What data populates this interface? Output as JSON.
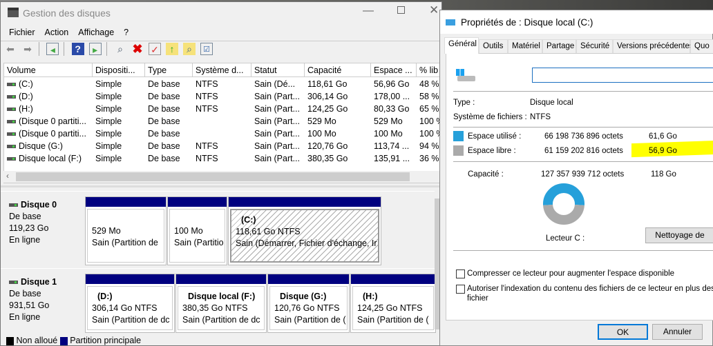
{
  "main_window": {
    "title": "Gestion des disques",
    "menu": [
      "Fichier",
      "Action",
      "Affichage",
      "?"
    ],
    "toolbar_icons": [
      "back-arrow-icon",
      "forward-arrow-icon",
      "console-tree-icon",
      "help-icon",
      "action-pane-icon",
      "connect-drive-icon",
      "delete-icon",
      "properties-icon",
      "folder-up-icon",
      "folder-search-icon",
      "checklist-icon"
    ],
    "columns": [
      "Volume",
      "Dispositi...",
      "Type",
      "Système d...",
      "Statut",
      "Capacité",
      "Espace ...",
      "% lib"
    ],
    "rows": [
      [
        "(C:)",
        "Simple",
        "De base",
        "NTFS",
        "Sain (Dé...",
        "118,61 Go",
        "56,96 Go",
        "48 %"
      ],
      [
        "(D:)",
        "Simple",
        "De base",
        "NTFS",
        "Sain (Part...",
        "306,14 Go",
        "178,00 ...",
        "58 %"
      ],
      [
        "(H:)",
        "Simple",
        "De base",
        "NTFS",
        "Sain (Part...",
        "124,25 Go",
        "80,33 Go",
        "65 %"
      ],
      [
        "(Disque 0 partiti...",
        "Simple",
        "De base",
        "",
        "Sain (Part...",
        "529 Mo",
        "529 Mo",
        "100 %"
      ],
      [
        "(Disque 0 partiti...",
        "Simple",
        "De base",
        "",
        "Sain (Part...",
        "100 Mo",
        "100 Mo",
        "100 %"
      ],
      [
        "Disque (G:)",
        "Simple",
        "De base",
        "NTFS",
        "Sain (Part...",
        "120,76 Go",
        "113,74 ...",
        "94 %"
      ],
      [
        "Disque local (F:)",
        "Simple",
        "De base",
        "NTFS",
        "Sain (Part...",
        "380,35 Go",
        "135,91 ...",
        "36 %"
      ]
    ],
    "disks": [
      {
        "name": "Disque 0",
        "type": "De base",
        "size": "119,23 Go",
        "status": "En ligne",
        "partitions": [
          {
            "label": "",
            "size": "529 Mo",
            "status": "Sain (Partition de"
          },
          {
            "label": "",
            "size": "100 Mo",
            "status": "Sain (Partitio"
          },
          {
            "label": "(C:)",
            "size": "118,61 Go NTFS",
            "status": "Sain (Démarrer, Fichier d'échange, Ir"
          }
        ]
      },
      {
        "name": "Disque 1",
        "type": "De base",
        "size": "931,51 Go",
        "status": "En ligne",
        "partitions": [
          {
            "label": "(D:)",
            "size": "306,14 Go NTFS",
            "status": "Sain (Partition de dc"
          },
          {
            "label": "Disque local  (F:)",
            "size": "380,35 Go NTFS",
            "status": "Sain (Partition de dc"
          },
          {
            "label": "Disque  (G:)",
            "size": "120,76 Go NTFS",
            "status": "Sain (Partition de ("
          },
          {
            "label": "(H:)",
            "size": "124,25 Go NTFS",
            "status": "Sain (Partition de ("
          }
        ]
      }
    ],
    "legend": [
      "Non alloué",
      "Partition principale"
    ]
  },
  "dialog": {
    "title": "Propriétés de : Disque local (C:)",
    "tabs": [
      "Général",
      "Outils",
      "Matériel",
      "Partage",
      "Sécurité",
      "Versions précédentes",
      "Quo"
    ],
    "name_value": "",
    "type_label": "Type :",
    "type_value": "Disque local",
    "fs_label": "Système de fichiers :",
    "fs_value": "NTFS",
    "used_label": "Espace utilisé :",
    "used_bytes": "66 198 736 896 octets",
    "used_gb": "61,6 Go",
    "free_label": "Espace libre :",
    "free_bytes": "61 159 202 816 octets",
    "free_gb": "56,9 Go",
    "cap_label": "Capacité :",
    "cap_bytes": "127 357 939 712 octets",
    "cap_gb": "118 Go",
    "drive_label": "Lecteur C :",
    "cleanup_button": "Nettoyage de",
    "compress_label": "Compresser ce lecteur pour augmenter l'espace disponible",
    "index_label": "Autoriser l'indexation du contenu des fichiers de ce lecteur en plus des pro",
    "index_label2": "fichier",
    "ok": "OK",
    "cancel": "Annuler",
    "used_fraction": 0.52,
    "colors": {
      "used": "#26a0da",
      "free": "#aaaaaa",
      "highlight": "#ffff00"
    }
  }
}
